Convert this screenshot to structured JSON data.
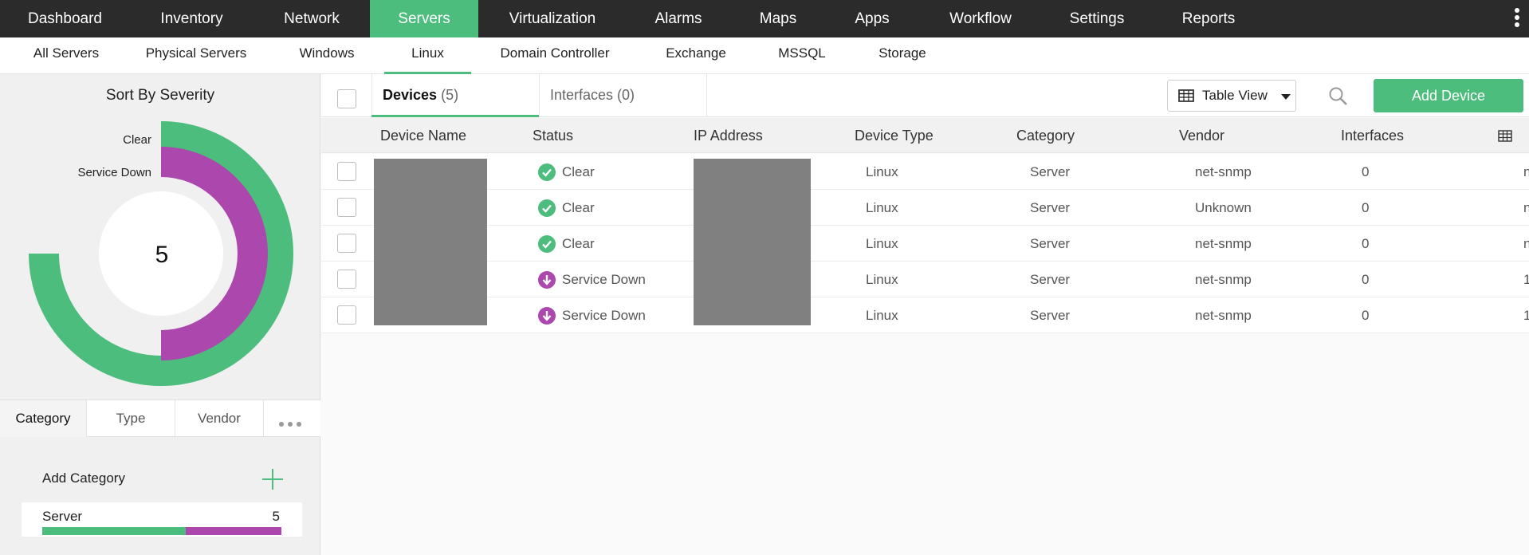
{
  "topnav": {
    "items": [
      "Dashboard",
      "Inventory",
      "Network",
      "Servers",
      "Virtualization",
      "Alarms",
      "Maps",
      "Apps",
      "Workflow",
      "Settings",
      "Reports"
    ],
    "active": "Servers"
  },
  "subnav": {
    "items": [
      "All Servers",
      "Physical Servers",
      "Windows",
      "Linux",
      "Domain Controller",
      "Exchange",
      "MSSQL",
      "Storage"
    ],
    "active": "Linux"
  },
  "severity": {
    "title": "Sort By Severity",
    "total": "5",
    "legend": {
      "clear": "Clear",
      "service_down": "Service Down"
    },
    "counts": {
      "clear": 3,
      "service_down": 2
    }
  },
  "category_tabs": [
    "Category",
    "Type",
    "Vendor"
  ],
  "categories": {
    "add_label": "Add Category",
    "items": [
      {
        "name": "Server",
        "count": "5",
        "clear_fraction": 0.6
      }
    ]
  },
  "device_tabs": {
    "devices_label": "Devices",
    "devices_count": "(5)",
    "interfaces_label": "Interfaces (0)"
  },
  "toolbar": {
    "view_label": "Table View",
    "add_label": "Add Device"
  },
  "table": {
    "columns": [
      "Device Name",
      "Status",
      "IP Address",
      "Device Type",
      "Category",
      "Vendor",
      "Interfaces"
    ],
    "rows": [
      {
        "status": "Clear",
        "type": "Linux",
        "category": "Server",
        "vendor": "net-snmp",
        "interfaces": "0",
        "extra": "n"
      },
      {
        "status": "Clear",
        "type": "Linux",
        "category": "Server",
        "vendor": "Unknown",
        "interfaces": "0",
        "extra": "n"
      },
      {
        "status": "Clear",
        "type": "Linux",
        "category": "Server",
        "vendor": "net-snmp",
        "interfaces": "0",
        "extra": "n"
      },
      {
        "status": "Service Down",
        "type": "Linux",
        "category": "Server",
        "vendor": "net-snmp",
        "interfaces": "0",
        "extra": "1"
      },
      {
        "status": "Service Down",
        "type": "Linux",
        "category": "Server",
        "vendor": "net-snmp",
        "interfaces": "0",
        "extra": "1"
      }
    ]
  },
  "colors": {
    "accent": "#4cbd7d",
    "clear": "#4cbd7d",
    "service_down": "#ab47ad"
  }
}
